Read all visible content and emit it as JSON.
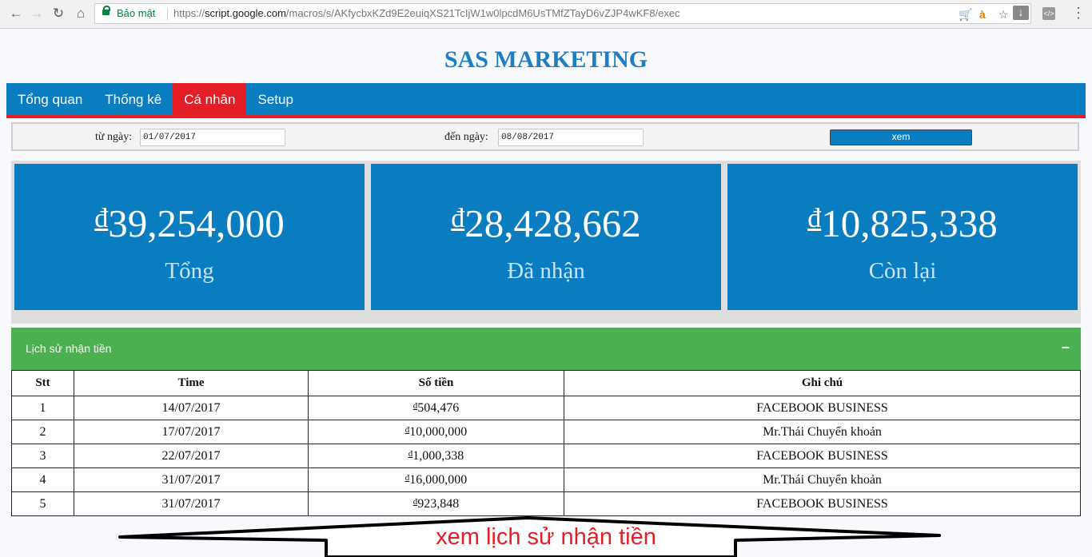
{
  "browser": {
    "secure_label": "Bảo mật",
    "url_scheme": "https://",
    "url_host": "script.google.com",
    "url_path": "/macros/s/AKfycbxKZd9E2euiqXS21TcIjW1w0lpcdM6UsTMfZTayD6vZJP4wKF8/exec",
    "ext_a_label": "à"
  },
  "page": {
    "brand": "SAS MARKETING"
  },
  "nav": {
    "items": [
      {
        "label": "Tổng quan"
      },
      {
        "label": "Thống kê"
      },
      {
        "label": "Cá nhân",
        "active": true
      },
      {
        "label": "Setup"
      }
    ]
  },
  "filter": {
    "from_label": "từ ngày:",
    "from_value": "01/07/2017",
    "to_label": "đến ngày:",
    "to_value": "08/08/2017",
    "button_label": "xem"
  },
  "stats": [
    {
      "currency": "đ",
      "value": "39,254,000",
      "label": "Tổng"
    },
    {
      "currency": "đ",
      "value": "28,428,662",
      "label": "Đã nhận"
    },
    {
      "currency": "đ",
      "value": "10,825,338",
      "label": "Còn lại"
    }
  ],
  "history": {
    "title": "Lịch sử nhận tiền",
    "toggle": "–",
    "columns": [
      "Stt",
      "Time",
      "Số tiền",
      "Ghi chú"
    ],
    "currency": "đ",
    "rows": [
      {
        "stt": "1",
        "time": "14/07/2017",
        "amount": "504,476",
        "note": "FACEBOOK BUSINESS"
      },
      {
        "stt": "2",
        "time": "17/07/2017",
        "amount": "10,000,000",
        "note": "Mr.Thái Chuyển khoản"
      },
      {
        "stt": "3",
        "time": "22/07/2017",
        "amount": "1,000,338",
        "note": "FACEBOOK BUSINESS"
      },
      {
        "stt": "4",
        "time": "31/07/2017",
        "amount": "16,000,000",
        "note": "Mr.Thái Chuyển khoản"
      },
      {
        "stt": "5",
        "time": "31/07/2017",
        "amount": "923,848",
        "note": "FACEBOOK BUSINESS"
      }
    ]
  },
  "annotation": {
    "text": "xem lịch sử nhận tiền"
  },
  "colors": {
    "brand_blue": "#0a7dc1",
    "accent_red": "#e41e26",
    "green_header": "#4caf50"
  },
  "icons": [
    "back-arrow-icon",
    "forward-arrow-icon",
    "reload-icon",
    "home-icon",
    "lock-icon",
    "cart-icon",
    "star-icon",
    "download-icon",
    "code-icon",
    "menu-icon"
  ]
}
